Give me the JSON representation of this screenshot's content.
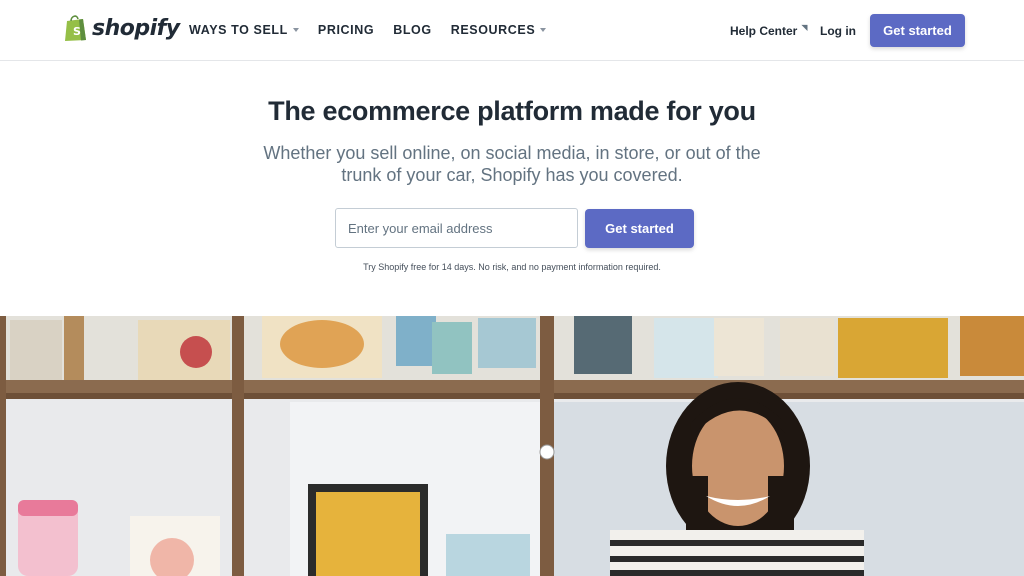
{
  "header": {
    "logo_text": "shopify",
    "nav": [
      {
        "label": "WAYS TO SELL",
        "has_dropdown": true
      },
      {
        "label": "PRICING",
        "has_dropdown": false
      },
      {
        "label": "BLOG",
        "has_dropdown": false
      },
      {
        "label": "RESOURCES",
        "has_dropdown": true
      }
    ],
    "help_center": "Help Center",
    "login": "Log in",
    "cta": "Get started"
  },
  "hero": {
    "title": "The ecommerce platform made for you",
    "subtitle": "Whether you sell online, on social media, in store, or out of the trunk of your car, Shopify has you covered.",
    "email_placeholder": "Enter your email address",
    "cta": "Get started",
    "note": "Try Shopify free for 14 days. No risk, and no payment information required."
  },
  "colors": {
    "brand_green": "#95bf47",
    "accent": "#5c6ac4",
    "text": "#212b36",
    "muted": "#637381"
  },
  "icons": {
    "logo": "shopping-bag-icon",
    "dropdown": "caret-down-icon",
    "external": "external-link-icon"
  }
}
